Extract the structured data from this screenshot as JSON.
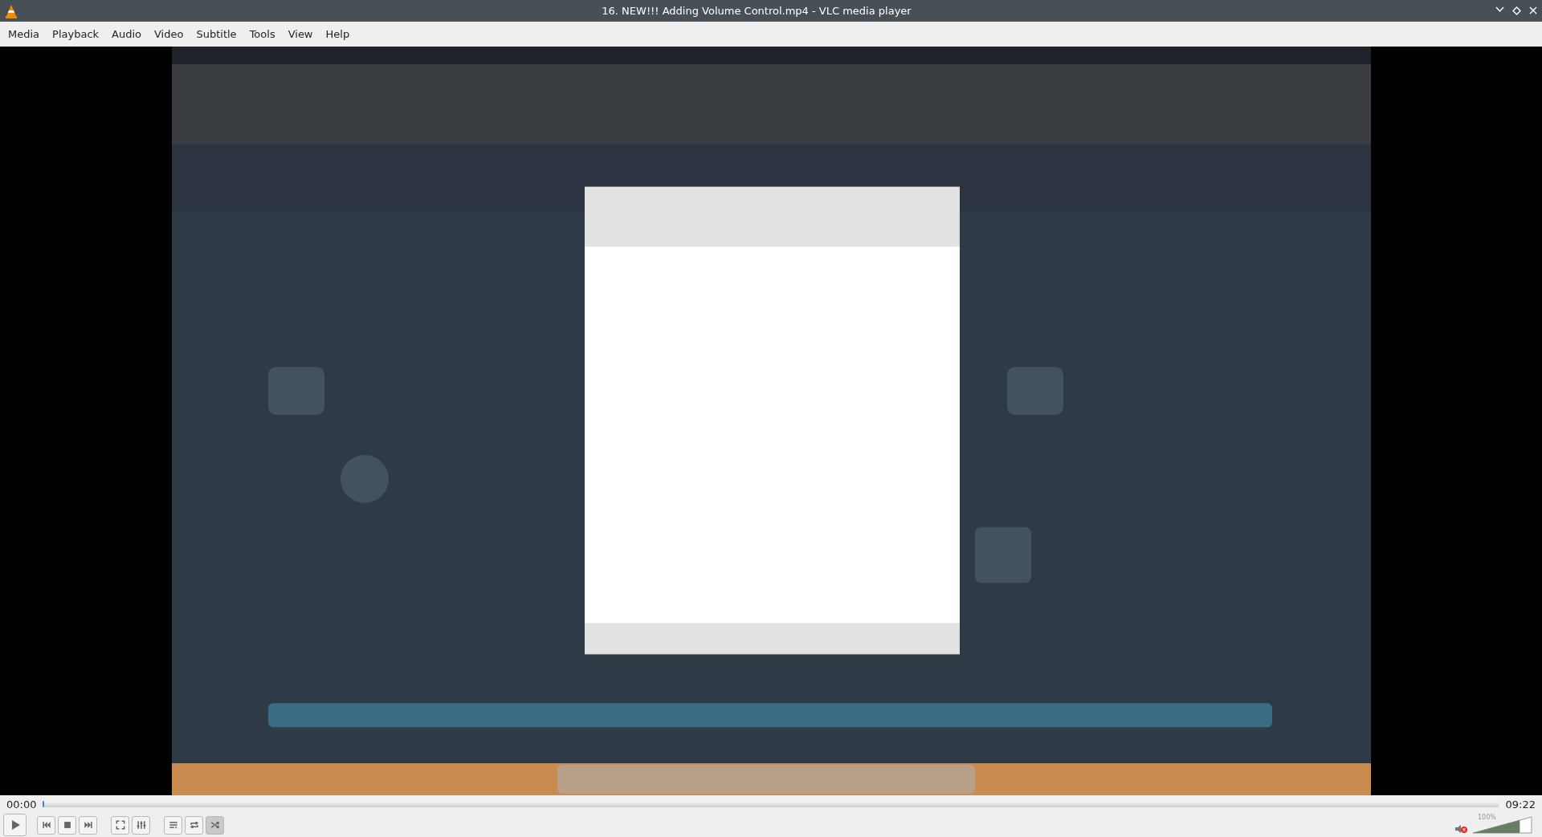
{
  "window": {
    "title": "16. NEW!!! Adding Volume Control.mp4 - VLC media player"
  },
  "menu": [
    "Media",
    "Playback",
    "Audio",
    "Video",
    "Subtitle",
    "Tools",
    "View",
    "Help"
  ],
  "video": {
    "kind": "picture"
  },
  "seek": {
    "elapsed": "00:00",
    "total": "09:22",
    "level": 0
  },
  "controls": [
    {
      "kind": "play",
      "selected": false
    },
    {
      "kind": "prev",
      "selected": false
    },
    {
      "kind": "stop",
      "selected": false
    },
    {
      "kind": "next",
      "selected": false
    },
    {
      "kind": "fullscreen",
      "selected": false
    },
    {
      "kind": "extended",
      "selected": false
    },
    {
      "kind": "playlist",
      "selected": false
    },
    {
      "kind": "loop",
      "selected": false
    },
    {
      "kind": "shuffle",
      "selected": true
    }
  ],
  "volume": {
    "muted": true,
    "level": 0.8,
    "reading": "100%"
  }
}
